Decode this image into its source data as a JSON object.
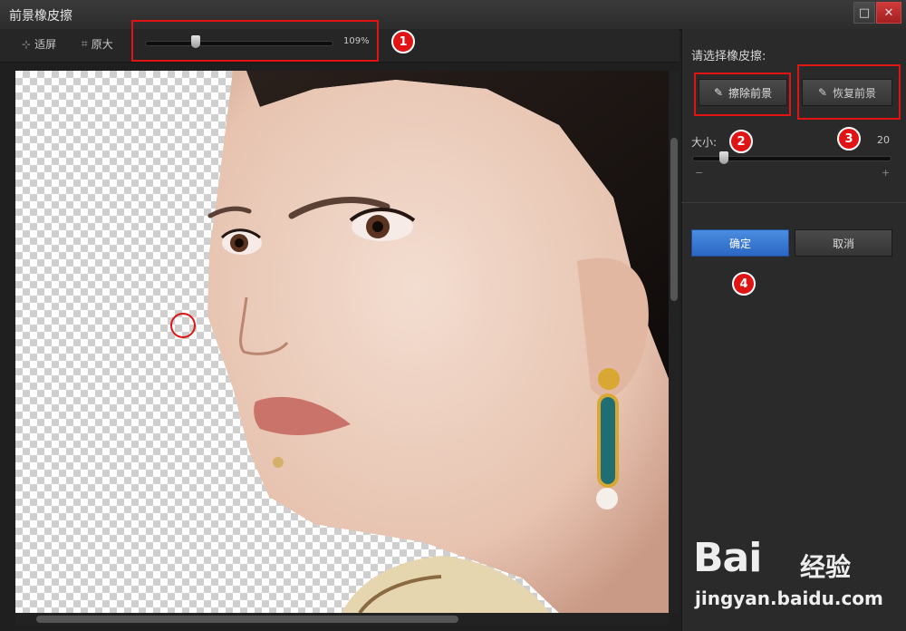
{
  "window": {
    "title": "前景橡皮擦",
    "maximize_icon": "maximize-icon",
    "close_icon": "close-icon"
  },
  "toolbar": {
    "fit_label": "适屏",
    "fit_icon": "fit-screen-icon",
    "original_label": "原大",
    "original_icon": "original-size-icon",
    "zoom_label": "109%",
    "zoom_value": 109
  },
  "panel": {
    "title": "请选择橡皮擦:",
    "erase_button": "擦除前景",
    "restore_button": "恢复前景",
    "eraser_icon": "eraser-icon",
    "size_label": "大小:",
    "size_value": "20",
    "minus_label": "−",
    "plus_label": "+",
    "ok_button": "确定",
    "cancel_button": "取消"
  },
  "callouts": [
    "1",
    "2",
    "3",
    "4"
  ],
  "colors": {
    "accent_blue": "#2b67c4",
    "callout_red": "#e01414",
    "panel_bg": "#2a2a2a"
  },
  "watermark": {
    "logo": "Bai",
    "logo_suffix": "经验",
    "url": "jingyan.baidu.com"
  }
}
